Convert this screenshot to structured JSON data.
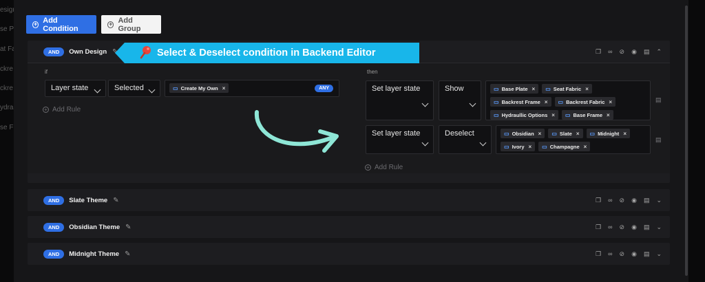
{
  "sidebar_fragments": [
    "esign",
    "se Pl",
    "at Fa",
    "ckre",
    "ckre",
    "ydrau",
    "se Fr"
  ],
  "toolbar": {
    "add_condition": "Add Condition",
    "add_group": "Add Group"
  },
  "callout": {
    "text": "Select & Deselect condition in Backend Editor"
  },
  "groups": [
    {
      "badge": "AND",
      "title": "Own Design",
      "if_label": "if",
      "then_label": "then",
      "if_rule": {
        "field": "Layer state",
        "operator": "Selected",
        "values": [
          "Create My Own"
        ],
        "match": "ANY"
      },
      "then_rules": [
        {
          "action": "Set layer state",
          "state": "Show",
          "values": [
            "Base Plate",
            "Seat Fabric",
            "Backrest Frame",
            "Backrest Fabric",
            "Hydraullic Options",
            "Base Frame"
          ]
        },
        {
          "action": "Set layer state",
          "state": "Deselect",
          "values": [
            "Obsidian",
            "Slate",
            "Midnight",
            "Ivory",
            "Champagne"
          ]
        }
      ],
      "add_rule": "Add Rule"
    },
    {
      "badge": "AND",
      "title": "Slate Theme"
    },
    {
      "badge": "AND",
      "title": "Obsidian Theme"
    },
    {
      "badge": "AND",
      "title": "Midnight Theme"
    }
  ],
  "icons": [
    "copy-icon",
    "link-icon",
    "unlink-icon",
    "eye-icon",
    "trash-icon",
    "chevron-icon"
  ],
  "colors": {
    "accent": "#2f6fe4",
    "callout": "#18b6ea",
    "arrow": "#8ee6d6",
    "background": "#161618"
  }
}
